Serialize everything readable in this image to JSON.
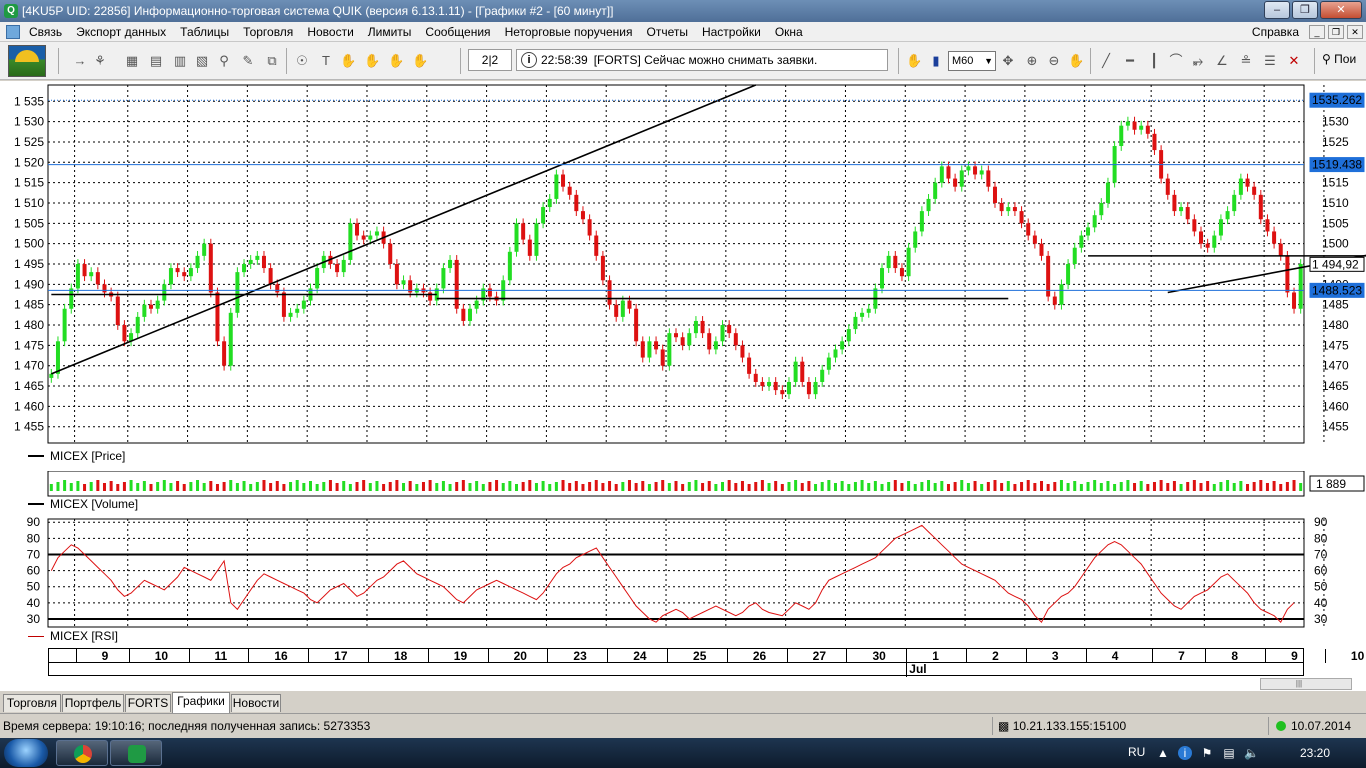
{
  "window": {
    "title": "[4KU5P UID: 22856] Информационно-торговая система QUIK (версия 6.13.1.11) - [Графики #2 - [60 минут]]",
    "app_icon": "Q"
  },
  "menu": {
    "items": [
      "Связь",
      "Экспорт данных",
      "Таблицы",
      "Торговля",
      "Новости",
      "Лимиты",
      "Сообщения",
      "Неторговые поручения",
      "Отчеты",
      "Настройки",
      "Окна"
    ],
    "help": "Справка"
  },
  "toolbar": {
    "page_indicator": "2|2",
    "message_time": "22:58:39",
    "message_text": "[FORTS] Сейчас можно снимать заявки.",
    "timeframe": "M60",
    "search_label": "Пои"
  },
  "chart_data": [
    {
      "type": "candlestick",
      "title": "MICEX [Price]",
      "ylim": [
        1451,
        1539
      ],
      "y_ticks": [
        "1 455",
        "1 460",
        "1 465",
        "1 470",
        "1 475",
        "1 480",
        "1 485",
        "1 490",
        "1 495",
        "1 500",
        "1 505",
        "1 510",
        "1 515",
        "1 520",
        "1 525",
        "1 530",
        "1 535"
      ],
      "y_right_ticks": [
        "1455",
        "1460",
        "1465",
        "1470",
        "1475",
        "1480",
        "1485",
        "1490",
        "1495",
        "1500",
        "1505",
        "1510",
        "1515",
        "1520",
        "1525",
        "1530"
      ],
      "price_labels": [
        {
          "value": "1535.262",
          "price": 1535.262,
          "color": "#1e6fd9",
          "style": "dotted"
        },
        {
          "value": "1519.438",
          "price": 1519.438,
          "color": "#1e6fd9",
          "style": "solid"
        },
        {
          "value": "1 494,92",
          "price": 1494.92,
          "color": "#ffffff",
          "style": "none"
        },
        {
          "value": "1488.523",
          "price": 1488.523,
          "color": "#1e6fd9",
          "style": "solid"
        }
      ],
      "closes": [
        1468,
        1476,
        1484,
        1489,
        1495,
        1492,
        1493,
        1490,
        1488,
        1487,
        1480,
        1476,
        1478,
        1482,
        1485,
        1484,
        1486,
        1490,
        1494,
        1493,
        1492,
        1494,
        1497,
        1500,
        1488,
        1476,
        1470,
        1483,
        1493,
        1495,
        1496,
        1497,
        1494,
        1490,
        1488,
        1482,
        1483,
        1484,
        1486,
        1489,
        1494,
        1497,
        1495,
        1493,
        1496,
        1505,
        1502,
        1501,
        1502,
        1503,
        1500,
        1495,
        1490,
        1491,
        1488,
        1489,
        1488,
        1486,
        1489,
        1494,
        1496,
        1484,
        1481,
        1484,
        1486,
        1489,
        1487,
        1486,
        1491,
        1498,
        1505,
        1501,
        1497,
        1505,
        1509,
        1511,
        1517,
        1514,
        1512,
        1508,
        1506,
        1502,
        1497,
        1491,
        1485,
        1482,
        1486,
        1484,
        1476,
        1472,
        1476,
        1474,
        1470,
        1478,
        1477,
        1475,
        1478,
        1481,
        1478,
        1474,
        1476,
        1480,
        1478,
        1475,
        1472,
        1468,
        1466,
        1465,
        1466,
        1464,
        1463,
        1466,
        1471,
        1466,
        1463,
        1466,
        1469,
        1472,
        1474,
        1476,
        1479,
        1482,
        1483,
        1484,
        1489,
        1494,
        1497,
        1494,
        1492,
        1499,
        1503,
        1508,
        1511,
        1515,
        1519,
        1516,
        1514,
        1518,
        1519,
        1517,
        1518,
        1514,
        1510,
        1508,
        1509,
        1508,
        1505,
        1502,
        1500,
        1497,
        1487,
        1485,
        1490,
        1495,
        1499,
        1502,
        1504,
        1507,
        1510,
        1515,
        1524,
        1529,
        1530,
        1528,
        1529,
        1527,
        1523,
        1516,
        1512,
        1508,
        1509,
        1506,
        1503,
        1500,
        1499,
        1502,
        1506,
        1508,
        1512,
        1516,
        1514,
        1512,
        1506,
        1503,
        1500,
        1497,
        1488,
        1484,
        1495
      ],
      "trendlines": [
        {
          "from": [
            0,
            1468
          ],
          "to": [
            106,
            1539
          ],
          "color": "#000"
        },
        {
          "from": [
            0,
            1487.5
          ],
          "to": [
            58,
            1487.5
          ],
          "color": "#000"
        },
        {
          "from": [
            58,
            1486.5
          ],
          "to": [
            144,
            1486.5
          ],
          "color": "#000"
        },
        {
          "from": [
            156,
            1497
          ],
          "to": [
            216,
            1497
          ],
          "color": "#000"
        },
        {
          "from": [
            168,
            1488
          ],
          "to": [
            204,
            1499
          ],
          "color": "#000"
        }
      ]
    },
    {
      "type": "bar",
      "title": "MICEX [Volume]",
      "last_value": "1 889"
    },
    {
      "type": "line",
      "title": "MICEX [RSI]",
      "ylim": [
        25,
        92
      ],
      "y_ticks": [
        "30",
        "40",
        "50",
        "60",
        "70",
        "80",
        "90"
      ],
      "levels": [
        30,
        70
      ],
      "values": [
        60,
        68,
        72,
        76,
        74,
        70,
        66,
        62,
        58,
        54,
        48,
        44,
        46,
        50,
        54,
        52,
        50,
        48,
        52,
        56,
        62,
        60,
        58,
        56,
        54,
        60,
        66,
        40,
        36,
        42,
        48,
        54,
        58,
        56,
        54,
        52,
        50,
        48,
        46,
        42,
        40,
        44,
        48,
        50,
        52,
        48,
        44,
        46,
        50,
        54,
        56,
        60,
        64,
        66,
        62,
        58,
        56,
        54,
        52,
        50,
        46,
        42,
        40,
        44,
        48,
        50,
        52,
        54,
        52,
        50,
        48,
        46,
        44,
        42,
        46,
        52,
        58,
        62,
        64,
        68,
        70,
        72,
        74,
        68,
        62,
        56,
        50,
        44,
        38,
        34,
        30,
        28,
        32,
        34,
        36,
        34,
        30,
        32,
        34,
        36,
        38,
        36,
        34,
        32,
        34,
        38,
        40,
        36,
        34,
        33,
        32,
        36,
        40,
        38,
        36,
        40,
        48,
        54,
        56,
        58,
        60,
        62,
        64,
        66,
        68,
        72,
        76,
        80,
        82,
        84,
        86,
        88,
        84,
        80,
        76,
        72,
        68,
        64,
        62,
        60,
        58,
        56,
        54,
        50,
        46,
        44,
        42,
        38,
        32,
        28,
        36,
        40,
        44,
        46,
        50,
        56,
        62,
        68,
        72,
        76,
        78,
        76,
        72,
        68,
        64,
        58,
        52,
        46,
        42,
        38,
        36,
        40,
        44,
        46,
        48,
        52,
        56,
        58,
        54,
        50,
        46,
        40,
        36,
        34,
        32,
        28,
        36,
        40
      ]
    }
  ],
  "date_axis": {
    "labels": [
      "9",
      "10",
      "11",
      "16",
      "17",
      "18",
      "19",
      "20",
      "23",
      "24",
      "25",
      "26",
      "27",
      "30",
      "1",
      "2",
      "3",
      "4",
      "7",
      "8",
      "9",
      "10"
    ],
    "month_label": "Jul"
  },
  "tabs": [
    "Торговля",
    "Портфель",
    "FORTS",
    "Графики",
    "Новости"
  ],
  "active_tab": "Графики",
  "status": {
    "left": "Время сервера: 19:10:16; последняя полученная запись: 5273353",
    "connection": "10.21.133.155:15100",
    "date": "10.07.2014"
  },
  "taskbar": {
    "lang": "RU",
    "clock": "23:20"
  }
}
